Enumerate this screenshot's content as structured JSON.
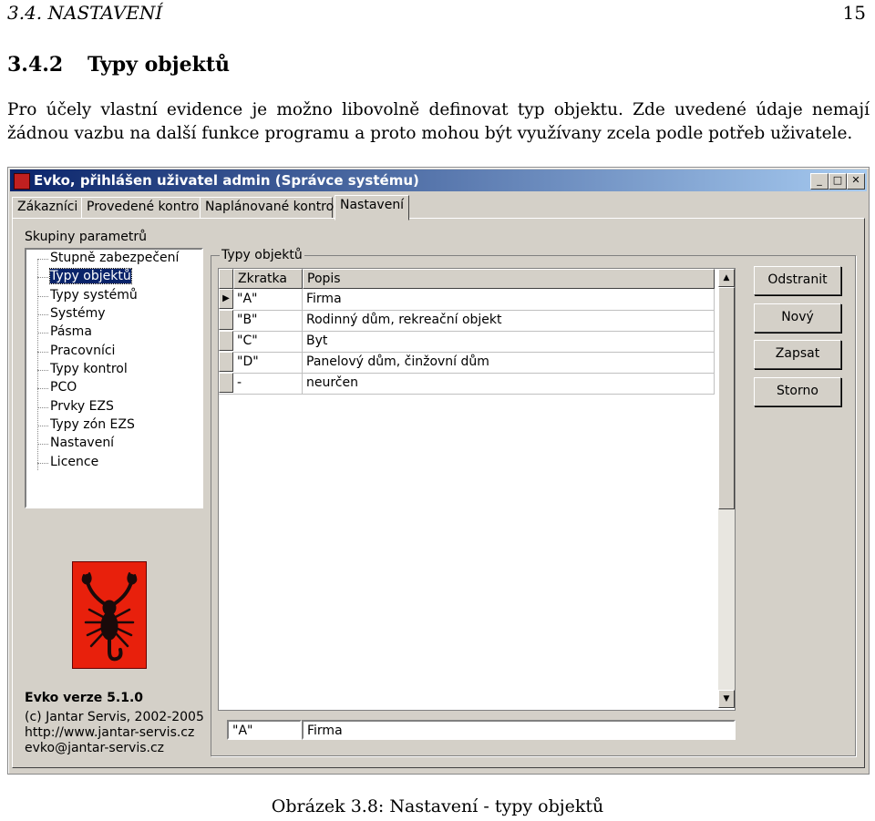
{
  "page": {
    "header_left": "3.4.  NASTAVENÍ",
    "header_right": "15",
    "section_number": "3.4.2",
    "section_title": "Typy objektů",
    "paragraph": "Pro účely vlastní evidence je možno libovolně definovat typ objektu. Zde uvedené údaje nemají žádnou vazbu na další funkce programu a proto mohou být využívany zcela podle potřeb uživatele.",
    "caption": "Obrázek 3.8: Nastavení - typy objektů"
  },
  "window": {
    "title": "Evko, přihlášen uživatel admin (Správce systému)",
    "controls": {
      "minimize": "_",
      "maximize": "□",
      "close": "✕"
    },
    "tabs": [
      "Zákazníci",
      "Provedené kontroly",
      "Naplánované kontroly",
      "Nastavení"
    ],
    "active_tab": "Nastavení",
    "group_label": "Skupiny parametrů",
    "tree_items": [
      "Stupně zabezpečení",
      "Typy objektů",
      "Typy systémů",
      "Systémy",
      "Pásma",
      "Pracovníci",
      "Typy kontrol",
      "PCO",
      "Prvky EZS",
      "Typy zón EZS",
      "Nastavení",
      "Licence"
    ],
    "selected_tree_item": "Typy objektů",
    "app_info": {
      "version": "Evko verze 5.1.0",
      "copyright": "(c) Jantar Servis, 2002-2005",
      "web": "http://www.jantar-servis.cz",
      "email": "evko@jantar-servis.cz"
    },
    "logo_icon": "scorpion-logo",
    "objects_group_title": "Typy objektů",
    "grid": {
      "columns": [
        "Zkratka",
        "Popis"
      ],
      "rows": [
        {
          "zkratka": "\"A\"",
          "popis": "Firma"
        },
        {
          "zkratka": "\"B\"",
          "popis": "Rodinný dům, rekreační objekt"
        },
        {
          "zkratka": "\"C\"",
          "popis": "Byt"
        },
        {
          "zkratka": "\"D\"",
          "popis": "Panelový dům, činžovní dům"
        },
        {
          "zkratka": "-",
          "popis": "neurčen"
        }
      ],
      "current_row_marker": "▶"
    },
    "buttons": [
      "Odstranit",
      "Nový",
      "Zapsat",
      "Storno"
    ],
    "edit": {
      "zkratka": "\"A\"",
      "popis": "Firma"
    }
  }
}
